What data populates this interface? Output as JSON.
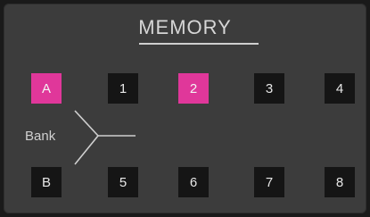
{
  "panel": {
    "title": "MEMORY",
    "bank_label": "Bank"
  },
  "top_row": [
    {
      "label": "A",
      "active": true
    },
    {
      "label": "1",
      "active": false
    },
    {
      "label": "2",
      "active": true
    },
    {
      "label": "3",
      "active": false
    },
    {
      "label": "4",
      "active": false
    }
  ],
  "bottom_row": [
    {
      "label": "B",
      "active": false
    },
    {
      "label": "5",
      "active": false
    },
    {
      "label": "6",
      "active": false
    },
    {
      "label": "7",
      "active": false
    },
    {
      "label": "8",
      "active": false
    }
  ],
  "colors": {
    "accent": "#e0379a",
    "button": "#151515",
    "panel": "#3c3c3c"
  }
}
